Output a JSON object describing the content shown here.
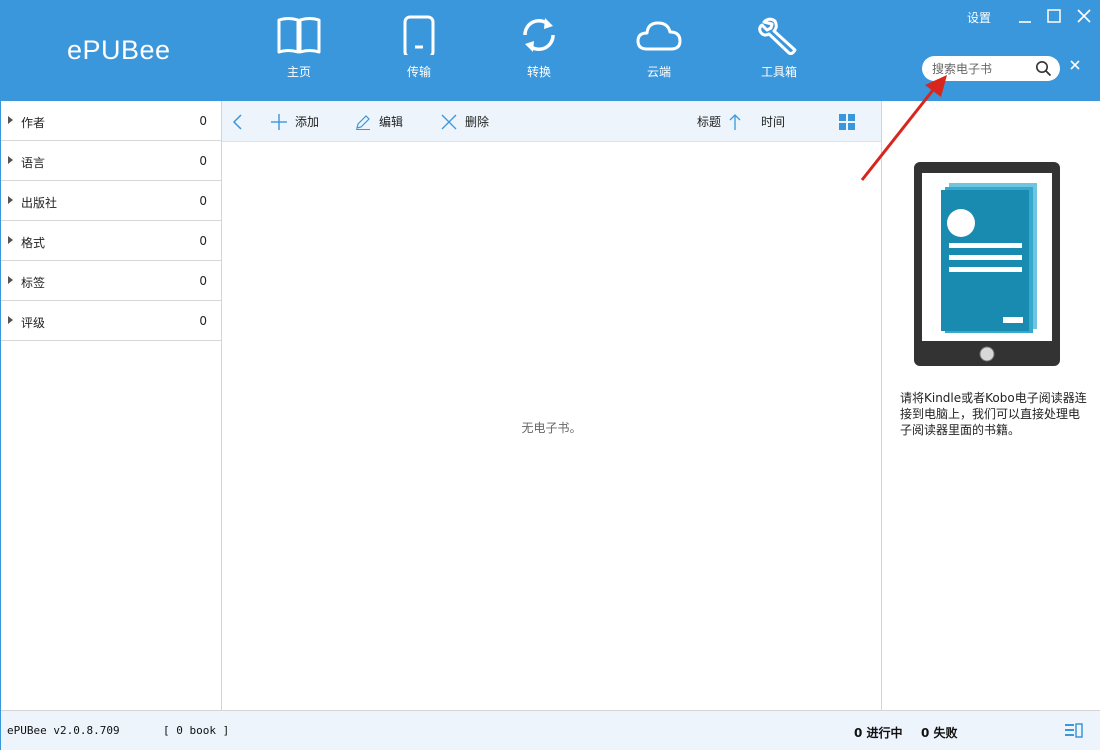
{
  "app": {
    "logo": "ePUBee",
    "settings_label": "设置"
  },
  "nav": [
    {
      "label": "主页",
      "icon": "book-open-icon"
    },
    {
      "label": "传输",
      "icon": "phone-icon"
    },
    {
      "label": "转换",
      "icon": "convert-arrows-icon"
    },
    {
      "label": "云端",
      "icon": "cloud-icon"
    },
    {
      "label": "工具箱",
      "icon": "wrench-icon"
    }
  ],
  "search": {
    "placeholder": "搜索电子书",
    "value": ""
  },
  "sidebar": {
    "filters": [
      {
        "label": "作者",
        "count": "0"
      },
      {
        "label": "语言",
        "count": "0"
      },
      {
        "label": "出版社",
        "count": "0"
      },
      {
        "label": "格式",
        "count": "0"
      },
      {
        "label": "标签",
        "count": "0"
      },
      {
        "label": "评级",
        "count": "0"
      }
    ]
  },
  "toolbar": {
    "add_label": "添加",
    "edit_label": "编辑",
    "delete_label": "删除",
    "sort_title_label": "标题",
    "sort_time_label": "时间"
  },
  "content": {
    "empty_message": "无电子书。"
  },
  "rightpanel": {
    "hint": "请将Kindle或者Kobo电子阅读器连接到电脑上，我们可以直接处理电子阅读器里面的书籍。"
  },
  "status": {
    "version": "ePUBee v2.0.8.709",
    "books": "[ 0 book ]",
    "in_progress": "0 进行中",
    "failed": "0 失败"
  },
  "colors": {
    "header": "#3a97db",
    "toolbar": "#edf4fb",
    "device_accent": "#1a8bb0",
    "annotation": "#d9261c"
  }
}
